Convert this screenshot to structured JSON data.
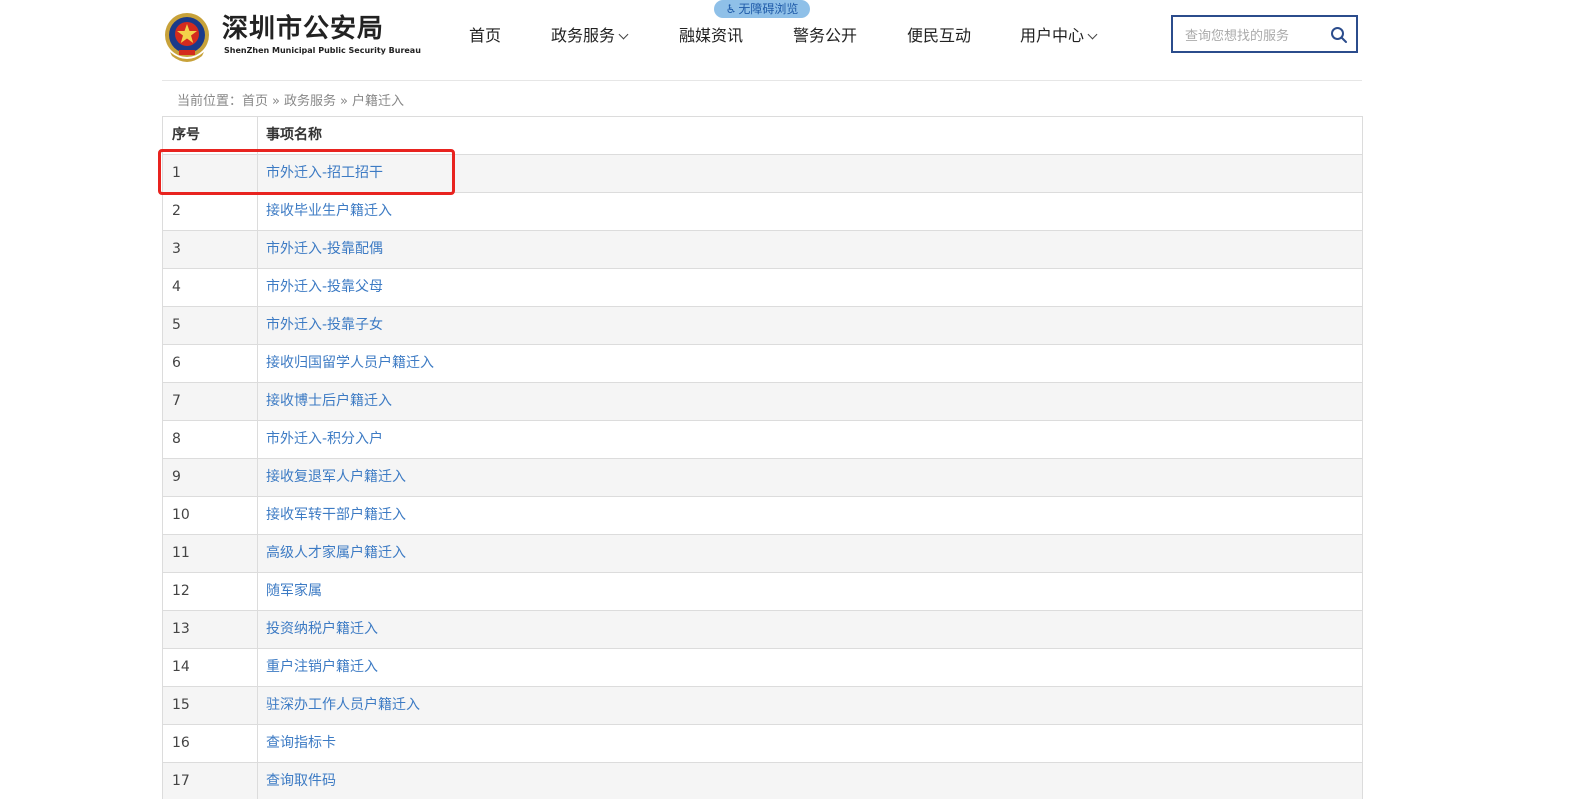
{
  "header": {
    "title": "深圳市公安局",
    "subtitle": "ShenZhen Municipal Public Security Bureau",
    "logo_icon": "police-emblem-icon",
    "accessibility_label": "无障碍浏览",
    "nav": [
      {
        "label": "首页",
        "has_dropdown": false
      },
      {
        "label": "政务服务",
        "has_dropdown": true
      },
      {
        "label": "融媒资讯",
        "has_dropdown": false
      },
      {
        "label": "警务公开",
        "has_dropdown": false
      },
      {
        "label": "便民互动",
        "has_dropdown": false
      },
      {
        "label": "用户中心",
        "has_dropdown": true
      }
    ],
    "search": {
      "placeholder": "查询您想找的服务",
      "value": ""
    }
  },
  "breadcrumb": {
    "prefix": "当前位置：",
    "items": [
      "首页",
      "政务服务",
      "户籍迁入"
    ],
    "separator": "»"
  },
  "table": {
    "columns": [
      "序号",
      "事项名称"
    ],
    "rows": [
      {
        "no": "1",
        "name": "市外迁入-招工招干"
      },
      {
        "no": "2",
        "name": "接收毕业生户籍迁入"
      },
      {
        "no": "3",
        "name": "市外迁入-投靠配偶"
      },
      {
        "no": "4",
        "name": "市外迁入-投靠父母"
      },
      {
        "no": "5",
        "name": "市外迁入-投靠子女"
      },
      {
        "no": "6",
        "name": "接收归国留学人员户籍迁入"
      },
      {
        "no": "7",
        "name": "接收博士后户籍迁入"
      },
      {
        "no": "8",
        "name": "市外迁入-积分入户"
      },
      {
        "no": "9",
        "name": "接收复退军人户籍迁入"
      },
      {
        "no": "10",
        "name": "接收军转干部户籍迁入"
      },
      {
        "no": "11",
        "name": "高级人才家属户籍迁入"
      },
      {
        "no": "12",
        "name": "随军家属"
      },
      {
        "no": "13",
        "name": "投资纳税户籍迁入"
      },
      {
        "no": "14",
        "name": "重户注销户籍迁入"
      },
      {
        "no": "15",
        "name": "驻深办工作人员户籍迁入"
      },
      {
        "no": "16",
        "name": "查询指标卡"
      },
      {
        "no": "17",
        "name": "查询取件码"
      }
    ]
  },
  "colors": {
    "link": "#3d7bc4",
    "highlight": "#e8231f",
    "search_border": "#2b4c8c",
    "row_alt": "#f5f5f5"
  }
}
